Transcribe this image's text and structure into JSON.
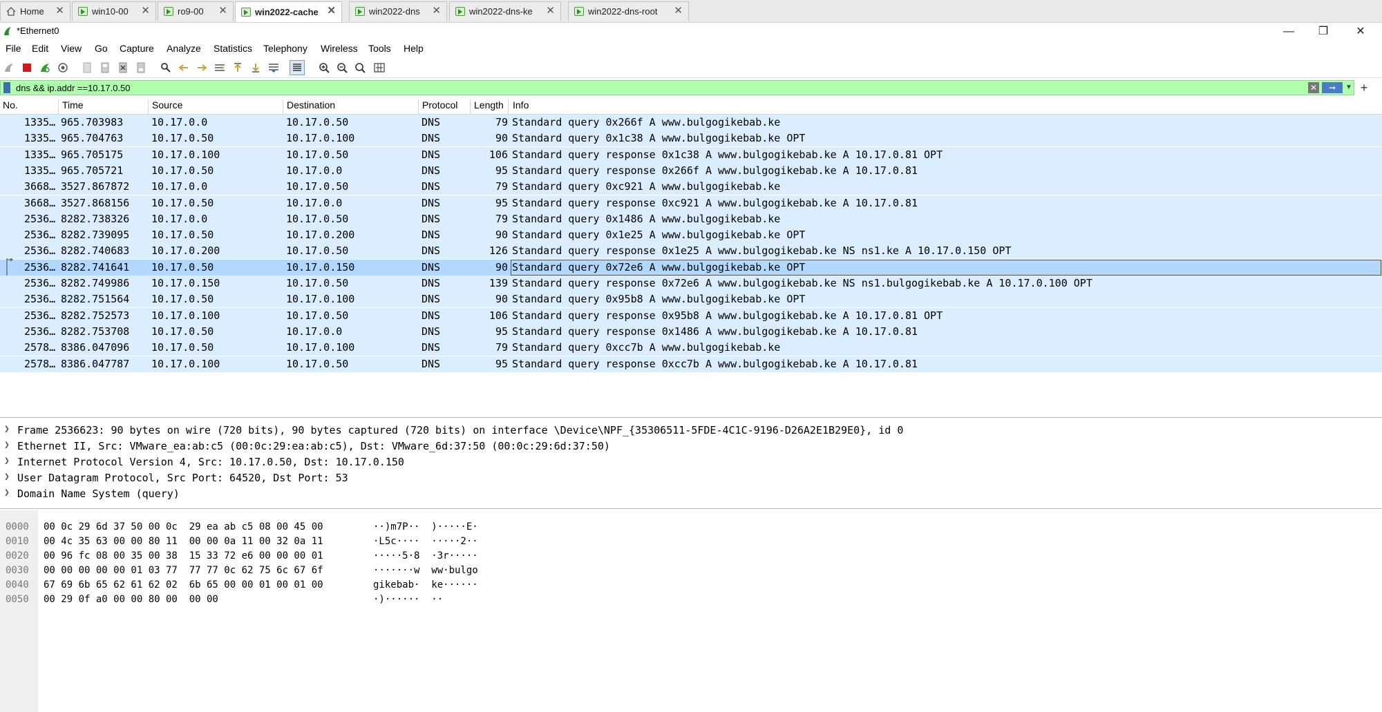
{
  "tabs": [
    {
      "label": "Home",
      "icon": "home-icon",
      "active": false
    },
    {
      "label": "win10-00",
      "icon": "vm-icon",
      "active": false
    },
    {
      "label": "ro9-00",
      "icon": "vm-icon",
      "active": false
    },
    {
      "label": "win2022-cache",
      "icon": "vm-icon",
      "active": true
    },
    {
      "label": "win2022-dns",
      "icon": "vm-icon",
      "active": false
    },
    {
      "label": "win2022-dns-ke",
      "icon": "vm-icon",
      "active": false
    },
    {
      "label": "win2022-dns-root",
      "icon": "vm-icon",
      "active": false
    }
  ],
  "window": {
    "title": "*Ethernet0"
  },
  "menu": [
    "File",
    "Edit",
    "View",
    "Go",
    "Capture",
    "Analyze",
    "Statistics",
    "Telephony",
    "Wireless",
    "Tools",
    "Help"
  ],
  "filter": {
    "value": "dns && ip.addr ==10.17.0.50"
  },
  "columns": [
    "No.",
    "Time",
    "Source",
    "Destination",
    "Protocol",
    "Length",
    "Info"
  ],
  "packets": [
    {
      "no": "1335…",
      "time": "965.703983",
      "src": "10.17.0.0",
      "dst": "10.17.0.50",
      "proto": "DNS",
      "len": "79",
      "info": "Standard query 0x266f A www.bulgogikebab.ke"
    },
    {
      "no": "1335…",
      "time": "965.704763",
      "src": "10.17.0.50",
      "dst": "10.17.0.100",
      "proto": "DNS",
      "len": "90",
      "info": "Standard query 0x1c38 A www.bulgogikebab.ke OPT"
    },
    {
      "no": "1335…",
      "time": "965.705175",
      "src": "10.17.0.100",
      "dst": "10.17.0.50",
      "proto": "DNS",
      "len": "106",
      "info": "Standard query response 0x1c38 A www.bulgogikebab.ke A 10.17.0.81 OPT"
    },
    {
      "no": "1335…",
      "time": "965.705721",
      "src": "10.17.0.50",
      "dst": "10.17.0.0",
      "proto": "DNS",
      "len": "95",
      "info": "Standard query response 0x266f A www.bulgogikebab.ke A 10.17.0.81"
    },
    {
      "no": "3668…",
      "time": "3527.867872",
      "src": "10.17.0.0",
      "dst": "10.17.0.50",
      "proto": "DNS",
      "len": "79",
      "info": "Standard query 0xc921 A www.bulgogikebab.ke"
    },
    {
      "no": "3668…",
      "time": "3527.868156",
      "src": "10.17.0.50",
      "dst": "10.17.0.0",
      "proto": "DNS",
      "len": "95",
      "info": "Standard query response 0xc921 A www.bulgogikebab.ke A 10.17.0.81"
    },
    {
      "no": "2536…",
      "time": "8282.738326",
      "src": "10.17.0.0",
      "dst": "10.17.0.50",
      "proto": "DNS",
      "len": "79",
      "info": "Standard query 0x1486 A www.bulgogikebab.ke"
    },
    {
      "no": "2536…",
      "time": "8282.739095",
      "src": "10.17.0.50",
      "dst": "10.17.0.200",
      "proto": "DNS",
      "len": "90",
      "info": "Standard query 0x1e25 A www.bulgogikebab.ke OPT"
    },
    {
      "no": "2536…",
      "time": "8282.740683",
      "src": "10.17.0.200",
      "dst": "10.17.0.50",
      "proto": "DNS",
      "len": "126",
      "info": "Standard query response 0x1e25 A www.bulgogikebab.ke NS ns1.ke A 10.17.0.150 OPT"
    },
    {
      "no": "2536…",
      "time": "8282.741641",
      "src": "10.17.0.50",
      "dst": "10.17.0.150",
      "proto": "DNS",
      "len": "90",
      "info": "Standard query 0x72e6 A www.bulgogikebab.ke OPT"
    },
    {
      "no": "2536…",
      "time": "8282.749986",
      "src": "10.17.0.150",
      "dst": "10.17.0.50",
      "proto": "DNS",
      "len": "139",
      "info": "Standard query response 0x72e6 A www.bulgogikebab.ke NS ns1.bulgogikebab.ke A 10.17.0.100 OPT"
    },
    {
      "no": "2536…",
      "time": "8282.751564",
      "src": "10.17.0.50",
      "dst": "10.17.0.100",
      "proto": "DNS",
      "len": "90",
      "info": "Standard query 0x95b8 A www.bulgogikebab.ke OPT"
    },
    {
      "no": "2536…",
      "time": "8282.752573",
      "src": "10.17.0.100",
      "dst": "10.17.0.50",
      "proto": "DNS",
      "len": "106",
      "info": "Standard query response 0x95b8 A www.bulgogikebab.ke A 10.17.0.81 OPT"
    },
    {
      "no": "2536…",
      "time": "8282.753708",
      "src": "10.17.0.50",
      "dst": "10.17.0.0",
      "proto": "DNS",
      "len": "95",
      "info": "Standard query response 0x1486 A www.bulgogikebab.ke A 10.17.0.81"
    },
    {
      "no": "2578…",
      "time": "8386.047096",
      "src": "10.17.0.50",
      "dst": "10.17.0.100",
      "proto": "DNS",
      "len": "79",
      "info": "Standard query 0xcc7b A www.bulgogikebab.ke"
    },
    {
      "no": "2578…",
      "time": "8386.047787",
      "src": "10.17.0.100",
      "dst": "10.17.0.50",
      "proto": "DNS",
      "len": "95",
      "info": "Standard query response 0xcc7b A www.bulgogikebab.ke A 10.17.0.81"
    }
  ],
  "selected_row": 9,
  "details": [
    "Frame 2536623: 90 bytes on wire (720 bits), 90 bytes captured (720 bits) on interface \\Device\\NPF_{35306511-5FDE-4C1C-9196-D26A2E1B29E0}, id 0",
    "Ethernet II, Src: VMware_ea:ab:c5 (00:0c:29:ea:ab:c5), Dst: VMware_6d:37:50 (00:0c:29:6d:37:50)",
    "Internet Protocol Version 4, Src: 10.17.0.50, Dst: 10.17.0.150",
    "User Datagram Protocol, Src Port: 64520, Dst Port: 53",
    "Domain Name System (query)"
  ],
  "bytes": [
    {
      "offset": "0000",
      "hex": "00 0c 29 6d 37 50 00 0c  29 ea ab c5 08 00 45 00",
      "ascii": "··)m7P··  )·····E·"
    },
    {
      "offset": "0010",
      "hex": "00 4c 35 63 00 00 80 11  00 00 0a 11 00 32 0a 11",
      "ascii": "·L5c····  ·····2··"
    },
    {
      "offset": "0020",
      "hex": "00 96 fc 08 00 35 00 38  15 33 72 e6 00 00 00 01",
      "ascii": "·····5·8  ·3r·····"
    },
    {
      "offset": "0030",
      "hex": "00 00 00 00 00 01 03 77  77 77 0c 62 75 6c 67 6f",
      "ascii": "·······w  ww·bulgo"
    },
    {
      "offset": "0040",
      "hex": "67 69 6b 65 62 61 62 02  6b 65 00 00 01 00 01 00",
      "ascii": "gikebab·  ke······"
    },
    {
      "offset": "0050",
      "hex": "00 29 0f a0 00 00 80 00  00 00",
      "ascii": "·)······  ··"
    }
  ],
  "colors": {
    "row_bg": "#daeeff",
    "selected_bg": "#b3d8ff",
    "filter_bg": "#afffaf"
  }
}
